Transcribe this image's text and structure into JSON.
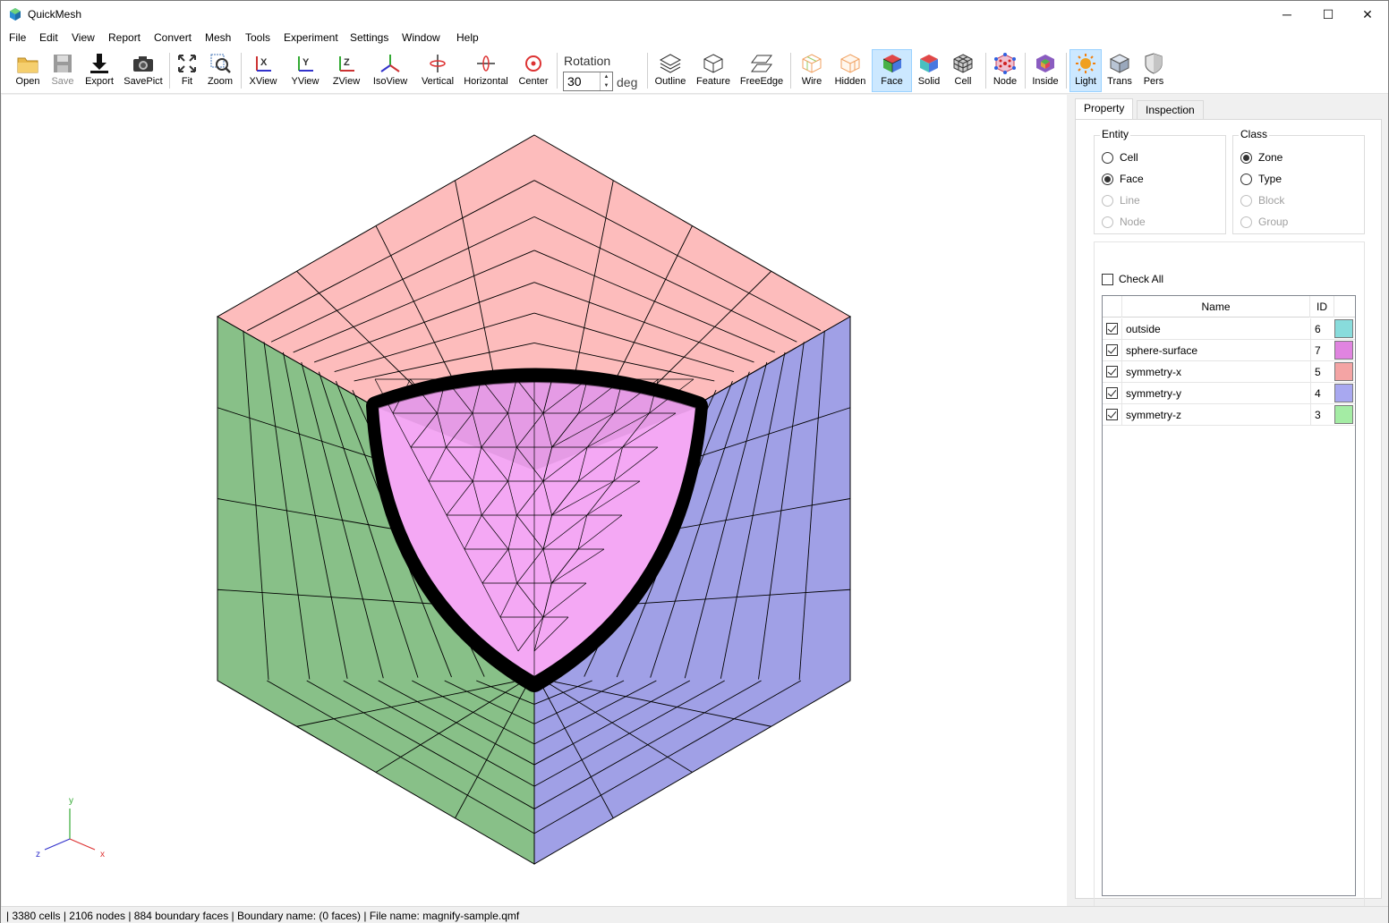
{
  "window": {
    "title": "QuickMesh",
    "minimize_glyph": "─",
    "maximize_glyph": "☐",
    "close_glyph": "✕"
  },
  "menu": [
    "File",
    "Edit",
    "View",
    "Report",
    "Convert",
    "Mesh",
    "Tools",
    "Experiment",
    "Settings",
    "Window",
    "Help"
  ],
  "toolbar": {
    "open": "Open",
    "save": "Save",
    "export": "Export",
    "savepict": "SavePict",
    "fit": "Fit",
    "zoom": "Zoom",
    "xview": "XView",
    "yview": "YView",
    "zview": "ZView",
    "isoview": "IsoView",
    "vertical": "Vertical",
    "horizontal": "Horizontal",
    "center": "Center",
    "rotation_label": "Rotation",
    "rotation_value": "30",
    "rotation_unit": "deg",
    "outline": "Outline",
    "feature": "Feature",
    "freeedge": "FreeEdge",
    "wire": "Wire",
    "hidden": "Hidden",
    "face": "Face",
    "solid": "Solid",
    "cell": "Cell",
    "node": "Node",
    "inside": "Inside",
    "light": "Light",
    "trans": "Trans",
    "pers": "Pers"
  },
  "viewport": {
    "axis_labels": {
      "x": "x",
      "y": "y",
      "z": "z"
    },
    "colors": {
      "symmetry_x": "#fdbcbc",
      "symmetry_y": "#a0a0e6",
      "symmetry_z": "#88c088",
      "sphere_surface": "#f4a8f4"
    }
  },
  "panel": {
    "tabs": [
      "Property",
      "Inspection"
    ],
    "entity_title": "Entity",
    "entity_options": [
      "Cell",
      "Face",
      "Line",
      "Node"
    ],
    "class_title": "Class",
    "class_options": [
      "Zone",
      "Type",
      "Block",
      "Group"
    ],
    "check_all": "Check All",
    "columns": [
      "Name",
      "ID"
    ],
    "zones": [
      {
        "name": "outside",
        "id": "6",
        "color": "#88dcdc",
        "checked": true
      },
      {
        "name": "sphere-surface",
        "id": "7",
        "color": "#e084e0",
        "checked": true
      },
      {
        "name": "symmetry-x",
        "id": "5",
        "color": "#f4a4a4",
        "checked": true
      },
      {
        "name": "symmetry-y",
        "id": "4",
        "color": "#a8a8f0",
        "checked": true
      },
      {
        "name": "symmetry-z",
        "id": "3",
        "color": "#a4eca4",
        "checked": true
      }
    ]
  },
  "status": {
    "text": "| 3380 cells | 2106 nodes | 884 boundary faces |  Boundary name:  (0 faces) | File name: magnify-sample.qmf"
  }
}
